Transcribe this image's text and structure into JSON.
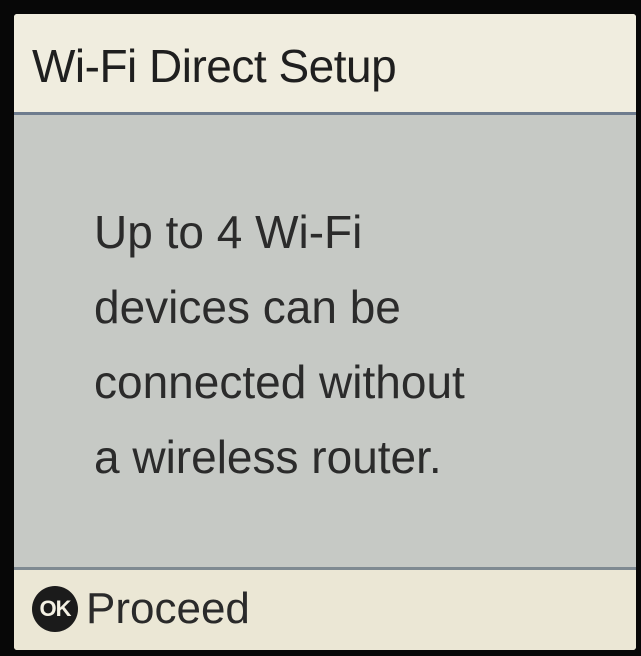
{
  "header": {
    "title": "Wi-Fi Direct Setup"
  },
  "message": {
    "lines": [
      "Up to 4 Wi-Fi",
      "devices can be",
      "connected without",
      "a wireless router."
    ]
  },
  "footer": {
    "ok_badge": "OK",
    "proceed_label": "Proceed"
  },
  "colors": {
    "bezel": "#070707",
    "title_background": "#f0eddf",
    "content_background": "#c6c9c5",
    "footer_background": "#ebe7d5",
    "divider": "#6e7c8e",
    "text": "#2b2b2b"
  }
}
